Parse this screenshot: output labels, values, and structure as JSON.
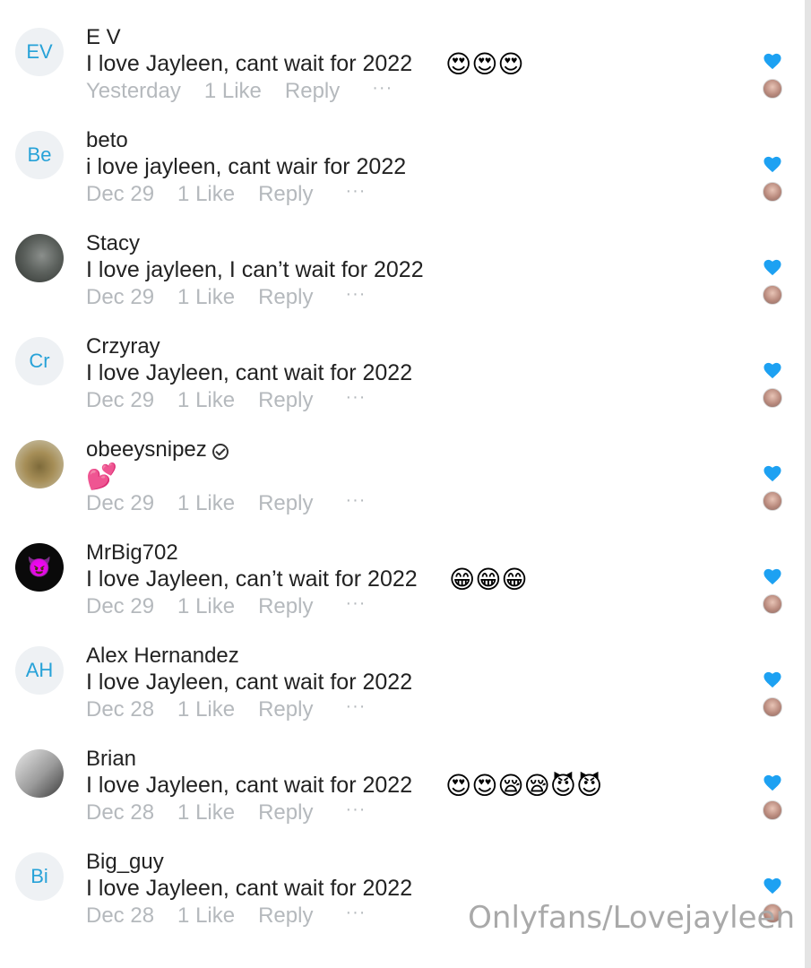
{
  "colors": {
    "accent": "#27a2d8",
    "heart": "#1da1f2",
    "meta_text": "#b5b9bd",
    "primary_text": "#222222",
    "watermark": "#a9a9a9"
  },
  "comments": [
    {
      "username": "E V",
      "avatar_initials": "EV",
      "text": "I love Jayleen, cant wait for 2022",
      "emojis": "😍😍😍",
      "time": "Yesterday",
      "likes": "1 Like",
      "reply": "Reply",
      "more": "···"
    },
    {
      "username": "beto",
      "avatar_initials": "Be",
      "text": "i love jayleen, cant wair for 2022",
      "emojis": "",
      "time": "Dec 29",
      "likes": "1 Like",
      "reply": "Reply",
      "more": "···"
    },
    {
      "username": "Stacy",
      "avatar_initials": "",
      "text": "I love jayleen, I can’t wait for 2022",
      "emojis": "",
      "time": "Dec 29",
      "likes": "1 Like",
      "reply": "Reply",
      "more": "···"
    },
    {
      "username": "Crzyray",
      "avatar_initials": "Cr",
      "text": "I love Jayleen, cant wait for 2022",
      "emojis": "",
      "time": "Dec 29",
      "likes": "1 Like",
      "reply": "Reply",
      "more": "···"
    },
    {
      "username": "obeeysnipez",
      "avatar_initials": "",
      "text": "",
      "emojis": "💕",
      "time": "Dec 29",
      "likes": "1 Like",
      "reply": "Reply",
      "more": "···"
    },
    {
      "username": "MrBig702",
      "avatar_initials": "😈",
      "text": "I love Jayleen, can’t wait for 2022",
      "emojis": "😁😁😁",
      "time": "Dec 29",
      "likes": "1 Like",
      "reply": "Reply",
      "more": "···"
    },
    {
      "username": "Alex Hernandez",
      "avatar_initials": "AH",
      "text": "I love Jayleen, cant wait for 2022",
      "emojis": "",
      "time": "Dec 28",
      "likes": "1 Like",
      "reply": "Reply",
      "more": "···"
    },
    {
      "username": "Brian",
      "avatar_initials": "",
      "text": "I love Jayleen, cant wait for 2022",
      "emojis": "😍😍😪😪😈😈",
      "time": "Dec 28",
      "likes": "1 Like",
      "reply": "Reply",
      "more": "···"
    },
    {
      "username": "Big_guy",
      "avatar_initials": "Bi",
      "text": "I love Jayleen, cant wait for 2022",
      "emojis": "",
      "time": "Dec 28",
      "likes": "1 Like",
      "reply": "Reply",
      "more": "···"
    }
  ],
  "watermark": "Onlyfans/Lovejayleen"
}
